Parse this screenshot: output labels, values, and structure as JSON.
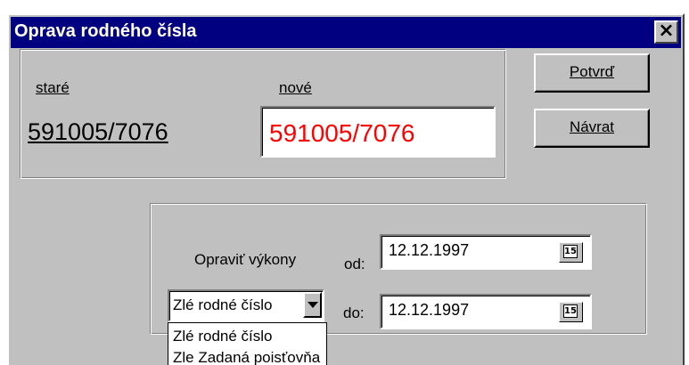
{
  "window": {
    "title": "Oprava rodného čísla",
    "close_glyph": "×"
  },
  "rodne_cislo": {
    "old_label": "staré",
    "new_label": "nové",
    "old_value": "591005/7076",
    "new_value": "591005/7076",
    "new_value_color": "#ff0000"
  },
  "buttons": {
    "confirm_label": "Potvrď",
    "return_label": "Návrat"
  },
  "oprava": {
    "label": "Opraviť výkony",
    "from_label": "od:",
    "to_label": "do:",
    "from_date": "12.12.1997",
    "to_date": "12.12.1997",
    "calendar_icon_text": "15"
  },
  "reason": {
    "selected": "Zlé rodné číslo",
    "options": [
      "Zlé rodné číslo",
      "Zle Zadaná poisťovňa"
    ]
  },
  "colors": {
    "title_bar": "#000080",
    "dialog_bg": "#c0c0c0"
  }
}
